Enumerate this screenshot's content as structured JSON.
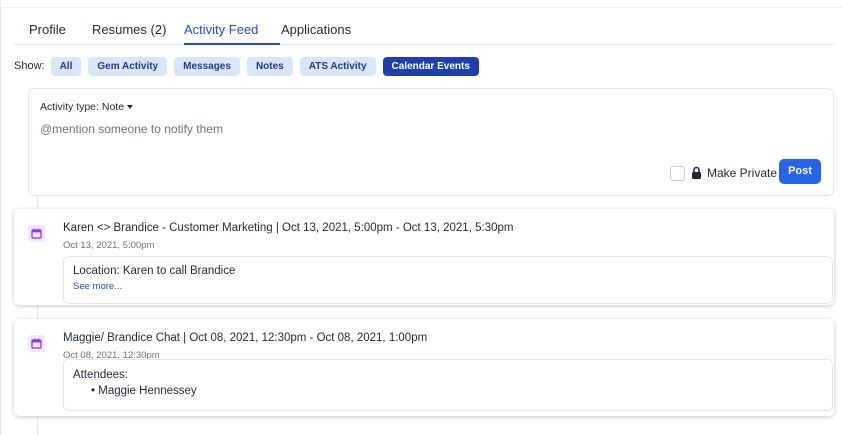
{
  "tabs": [
    {
      "label": "Profile"
    },
    {
      "label": "Resumes (2)"
    },
    {
      "label": "Activity Feed"
    },
    {
      "label": "Applications"
    }
  ],
  "active_tab": "Activity Feed",
  "filters": {
    "show_label": "Show:",
    "chips": [
      {
        "label": "All"
      },
      {
        "label": "Gem Activity"
      },
      {
        "label": "Messages"
      },
      {
        "label": "Notes"
      },
      {
        "label": "ATS Activity"
      },
      {
        "label": "Calendar Events"
      }
    ],
    "selected": "Calendar Events"
  },
  "composer": {
    "activity_type_label": "Activity type:",
    "activity_type_value": "Note",
    "placeholder": "@mention someone to notify them",
    "private_label": "Make Private",
    "post_label": "Post"
  },
  "events": [
    {
      "icon": "calendar-icon",
      "title": "Karen <> Brandice - Customer Marketing | Oct 13, 2021, 5:00pm - Oct 13, 2021, 5:30pm",
      "time": "Oct 13, 2021, 5:00pm",
      "location": "Location: Karen to call Brandice",
      "see_more": "See more..."
    },
    {
      "icon": "calendar-icon",
      "title": "Maggie/ Brandice Chat | Oct 08, 2021, 12:30pm - Oct 08, 2021, 1:00pm",
      "time": "Oct 08, 2021, 12:30pm",
      "attendees_label": "Attendees:",
      "attendees": [
        "Maggie Hennessey"
      ]
    }
  ],
  "colors": {
    "accent": "#2563eb",
    "tab_active": "#1d4ed8",
    "chip_bg": "#d9e6fa",
    "chip_selected_bg": "#1e40af",
    "calendar_icon": "#9333ea"
  }
}
